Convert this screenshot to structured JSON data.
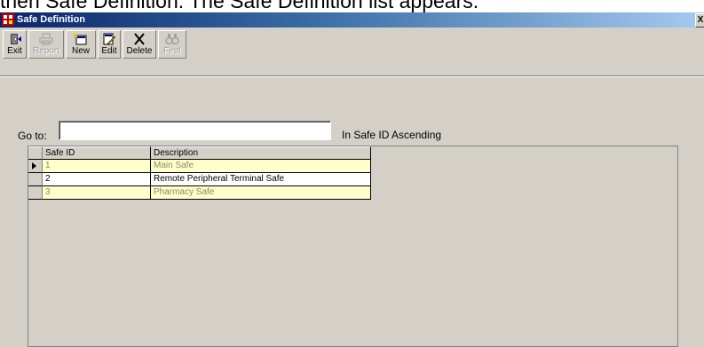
{
  "caption": "then Safe Definition. The Safe Definition list appears.",
  "window": {
    "title": "Safe Definition",
    "close_label": "X"
  },
  "toolbar": {
    "buttons": [
      {
        "label": "Exit",
        "icon": "exit-door-icon",
        "enabled": true
      },
      {
        "label": "Report",
        "icon": "printer-icon",
        "enabled": false
      },
      {
        "label": "New",
        "icon": "new-record-icon",
        "enabled": true
      },
      {
        "label": "Edit",
        "icon": "edit-record-icon",
        "enabled": true
      },
      {
        "label": "Delete",
        "icon": "delete-x-icon",
        "enabled": true
      },
      {
        "label": "Find",
        "icon": "binoculars-icon",
        "enabled": false
      }
    ]
  },
  "goto": {
    "label": "Go to:",
    "value": "",
    "sort_text": "In Safe ID Ascending"
  },
  "grid": {
    "columns": [
      "Safe ID",
      "Description"
    ],
    "rows": [
      {
        "id": "1",
        "description": "Main Safe",
        "current": true
      },
      {
        "id": "2",
        "description": "Remote Peripheral Terminal Safe",
        "current": false
      },
      {
        "id": "3",
        "description": "Pharmacy Safe",
        "current": false
      }
    ]
  },
  "colors": {
    "title_bar": "#0a246a",
    "row_highlight": "#ffffcc",
    "window_bg": "#d4d0c8"
  }
}
